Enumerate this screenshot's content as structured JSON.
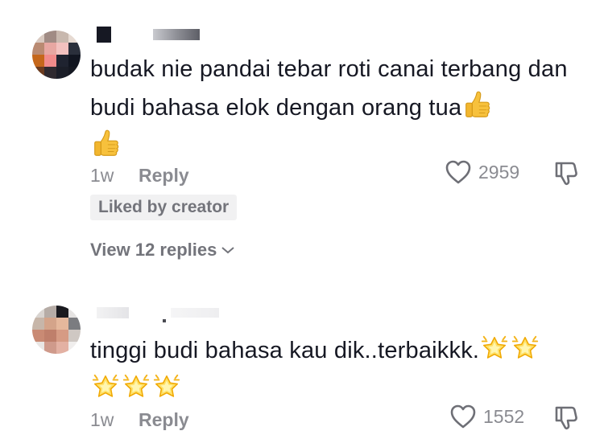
{
  "comments": [
    {
      "text": "budak nie pandai tebar roti canai terbang dan budi bahasa elok dengan orang tua",
      "time": "1w",
      "reply_label": "Reply",
      "likes": "2959",
      "liked_by_creator": "Liked by creator",
      "view_replies": "View 12 replies",
      "emojis": [
        "thumbs-up-icon",
        "thumbs-up-icon"
      ]
    },
    {
      "text": "tinggi budi bahasa kau dik..terbaikkk.",
      "time": "1w",
      "reply_label": "Reply",
      "likes": "1552",
      "emojis": [
        "glowing-star-icon",
        "glowing-star-icon",
        "glowing-star-icon",
        "glowing-star-icon",
        "glowing-star-icon"
      ]
    }
  ],
  "colors": {
    "text_primary": "#161823",
    "text_secondary": "#8a8b91",
    "badge_bg": "#f1f1f2"
  }
}
